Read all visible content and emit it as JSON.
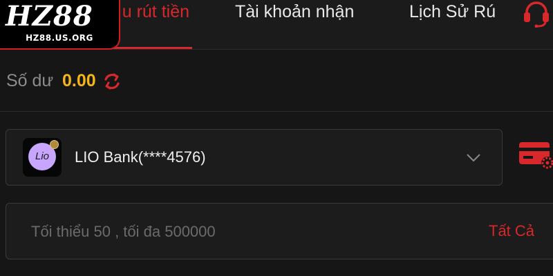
{
  "logo": {
    "main": "HZ88",
    "domain": "HZ88.US.ORG"
  },
  "tabs": [
    {
      "label": "u rút tiền",
      "active": true
    },
    {
      "label": "Tài khoản nhận",
      "active": false
    },
    {
      "label": "Lịch Sử Rú",
      "active": false
    }
  ],
  "support_icon": "headset-icon",
  "balance": {
    "label": "Số dư",
    "value": "0.00",
    "refresh_icon": "refresh-icon"
  },
  "bank": {
    "logo_text": "Lio",
    "name": "LIO Bank(****4576)",
    "chevron_icon": "chevron-down-icon"
  },
  "card_settings_icon": "card-settings-icon",
  "amount": {
    "placeholder": "Tối thiểu 50 , tối đa 500000",
    "value": "",
    "all_label": "Tất Cả"
  },
  "colors": {
    "accent": "#d8282b",
    "balance": "#f4b41a",
    "background": "#161616",
    "bank_logo": "#c8a6ff"
  }
}
